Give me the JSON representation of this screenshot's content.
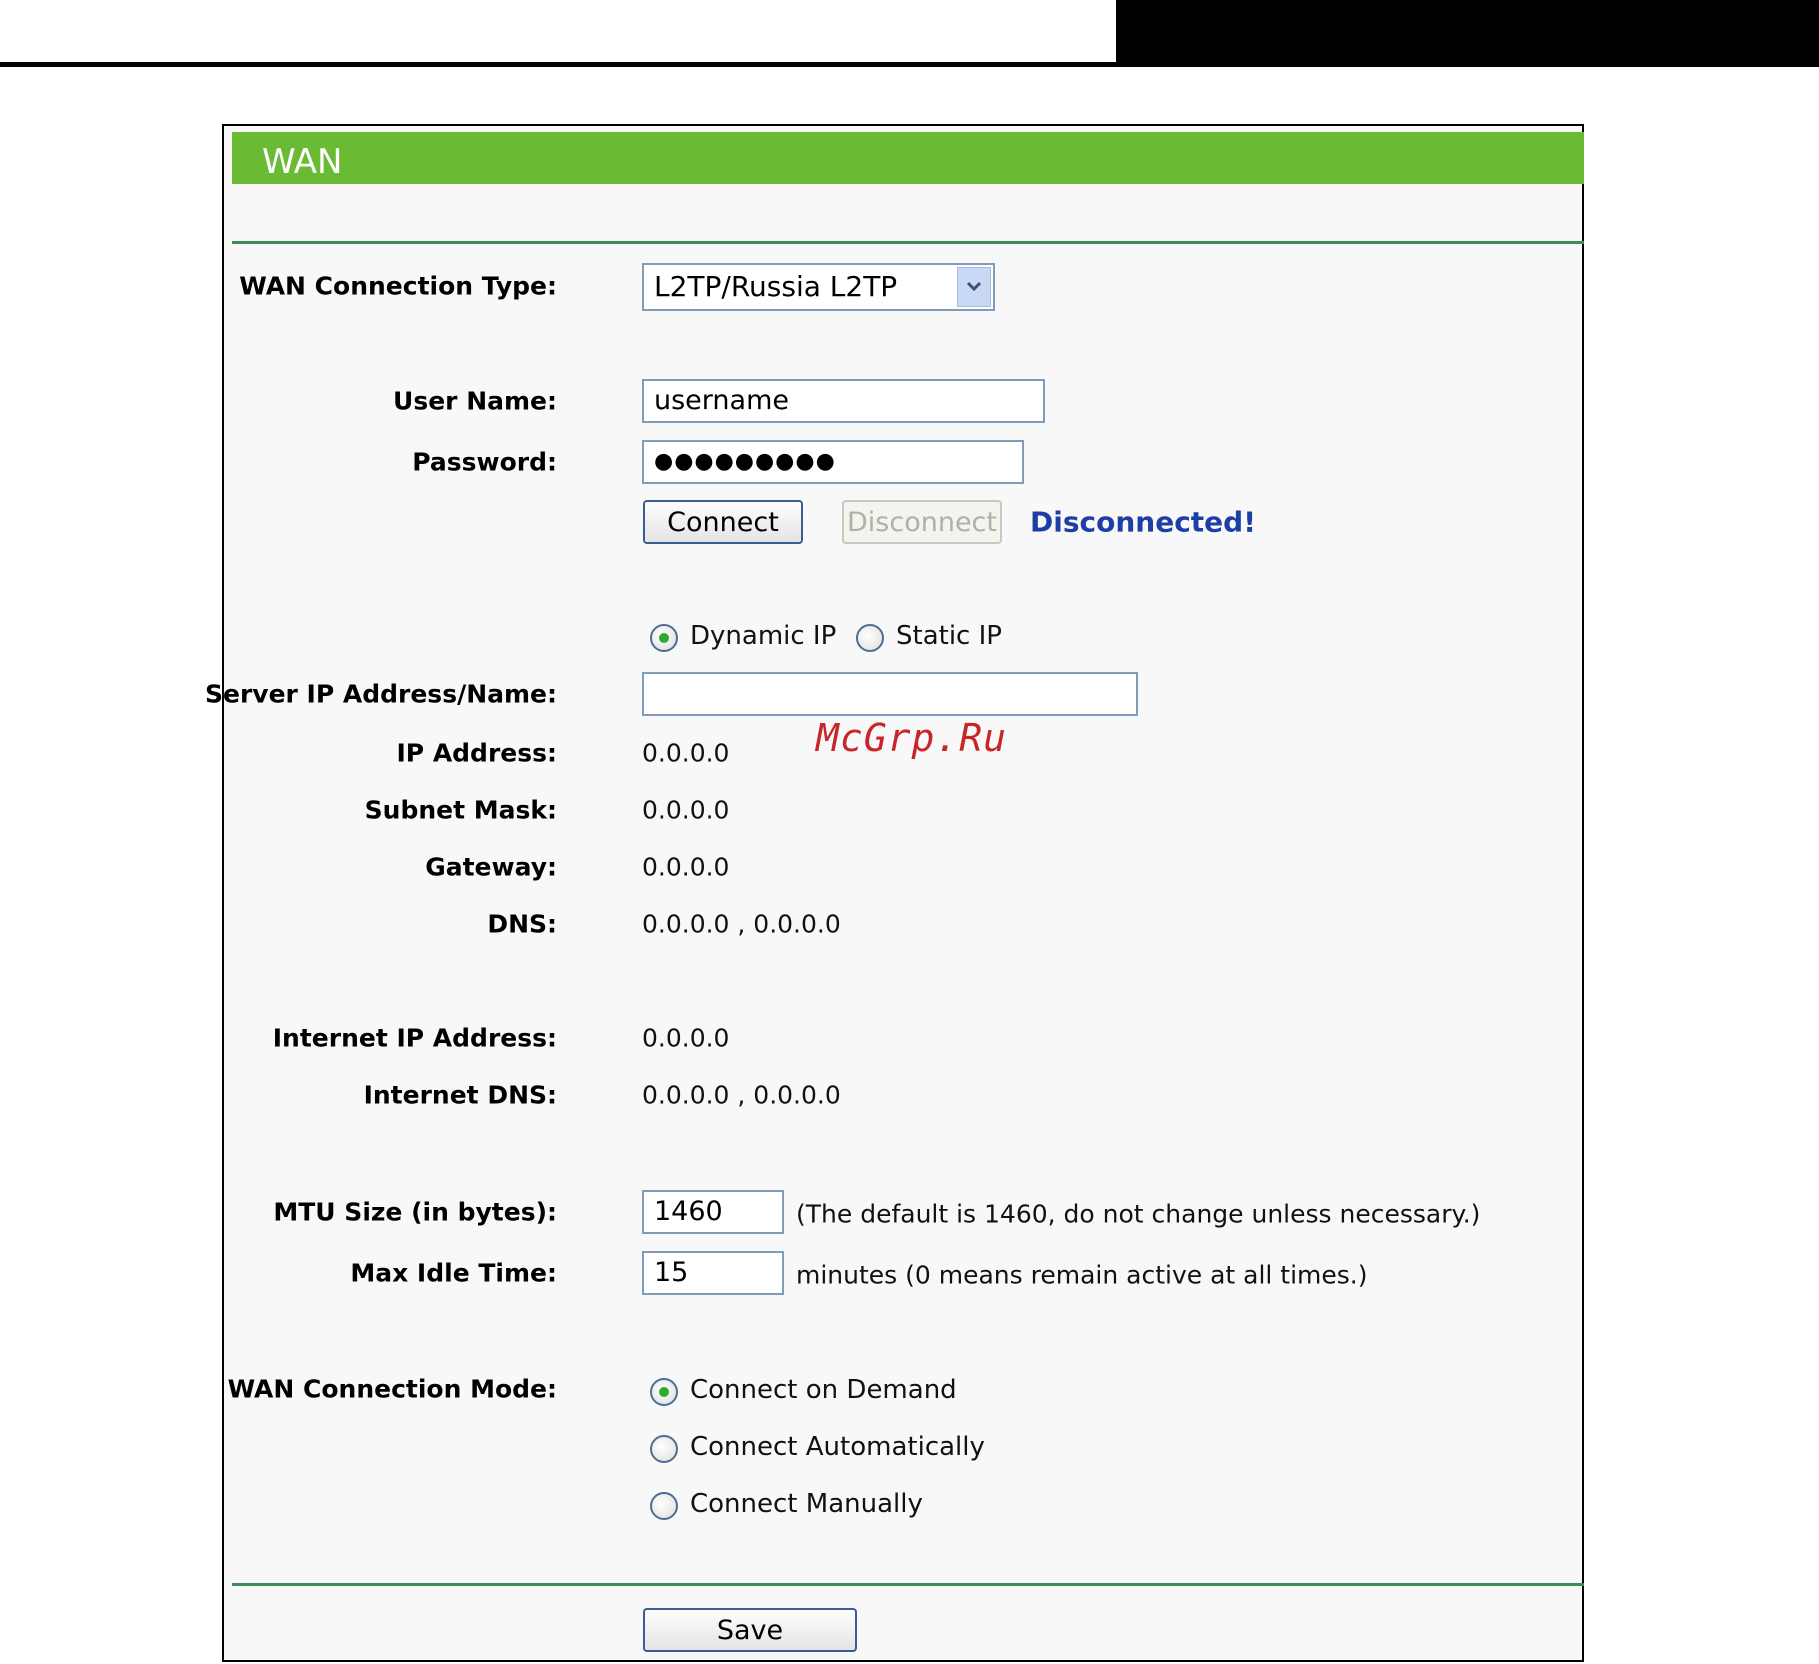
{
  "panel": {
    "title": "WAN",
    "accent": "#6aba34"
  },
  "connection_type": {
    "label": "WAN Connection Type:",
    "selected": "L2TP/Russia L2TP"
  },
  "credentials": {
    "user_label": "User Name:",
    "user_value": "username",
    "pass_label": "Password:",
    "pass_value": "●●●●●●●●●"
  },
  "actions": {
    "connect": "Connect",
    "disconnect": "Disconnect",
    "status": "Disconnected!"
  },
  "ip_mode": {
    "dynamic": "Dynamic IP",
    "static": "Static IP",
    "selected": "dynamic"
  },
  "server": {
    "label": "Server IP Address/Name:",
    "value": ""
  },
  "network": {
    "ip_label": "IP Address:",
    "ip_value": "0.0.0.0",
    "mask_label": "Subnet Mask:",
    "mask_value": "0.0.0.0",
    "gw_label": "Gateway:",
    "gw_value": "0.0.0.0",
    "dns_label": "DNS:",
    "dns_value": "0.0.0.0 , 0.0.0.0"
  },
  "internet": {
    "ip_label": "Internet IP Address:",
    "ip_value": "0.0.0.0",
    "dns_label": "Internet DNS:",
    "dns_value": "0.0.0.0 , 0.0.0.0"
  },
  "mtu": {
    "label": "MTU Size (in bytes):",
    "value": "1460",
    "hint": "(The default is 1460, do not change unless necessary.)"
  },
  "idle": {
    "label": "Max Idle Time:",
    "value": "15",
    "hint": "minutes (0 means remain active at all times.)"
  },
  "mode": {
    "label": "WAN Connection Mode:",
    "on_demand": "Connect on Demand",
    "automatic": "Connect Automatically",
    "manual": "Connect Manually",
    "selected": "on_demand"
  },
  "save": "Save",
  "watermark": "McGrp.Ru"
}
